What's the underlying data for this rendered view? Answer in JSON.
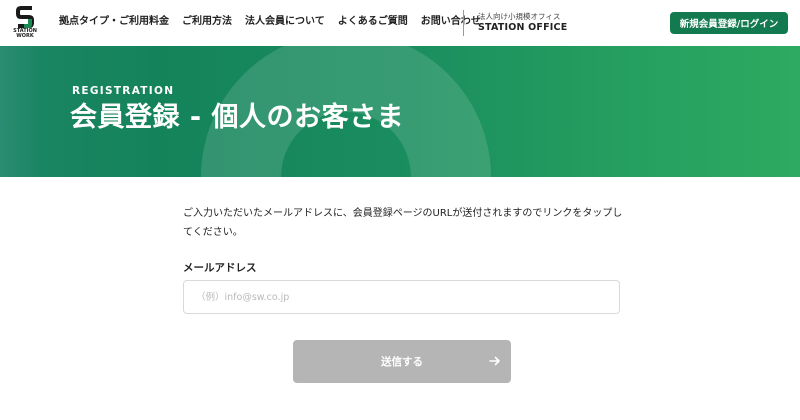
{
  "header": {
    "logo_text_1": "STATION",
    "logo_text_2": "WORK",
    "nav": [
      {
        "label": "拠点タイプ・ご利用料金"
      },
      {
        "label": "ご利用方法"
      },
      {
        "label": "法人会員について"
      },
      {
        "label": "よくあるご質問"
      },
      {
        "label": "お問い合わせ"
      }
    ],
    "corp_sub": "法人向け小規模オフィス",
    "corp_main": "STATION OFFICE",
    "login_button": "新規会員登録/ログイン"
  },
  "hero": {
    "kicker": "REGISTRATION",
    "title": "会員登録 - 個人のお客さま"
  },
  "form": {
    "instructions": "ご入力いただいたメールアドレスに、会員登録ページのURLが送付されますのでリンクをタップしてください。",
    "email_label": "メールアドレス",
    "email_placeholder": "（例）info@sw.co.jp",
    "email_value": "",
    "submit_label": "送信する",
    "submit_icon": "arrow-right-icon"
  },
  "colors": {
    "brand_green": "#137a4f",
    "hero_green_dark": "#14835b",
    "hero_green_light": "#2eaa62",
    "disabled_button": "#b5b5b5"
  }
}
